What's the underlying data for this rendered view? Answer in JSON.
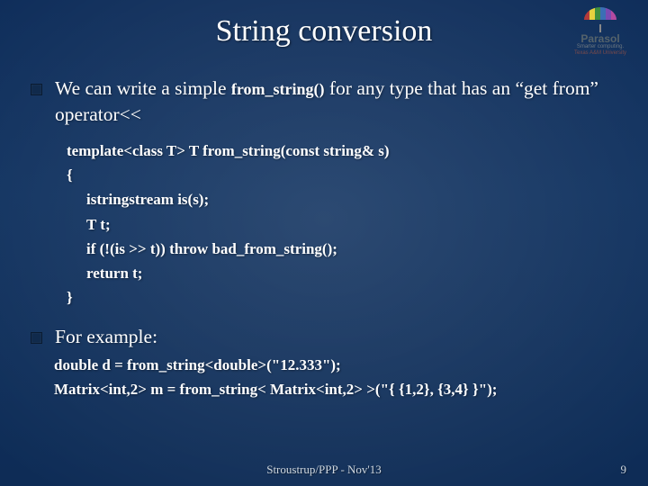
{
  "title": "String conversion",
  "logo": {
    "brand": "Parasol",
    "tag1": "Smarter computing.",
    "tag2": "Texas A&M University"
  },
  "bullets": {
    "b1_prefix": "We can write a simple ",
    "b1_code": "from_string()",
    "b1_suffix": " for any type that has an “get from” operator<<",
    "b2": "For example:"
  },
  "code": {
    "l1": "template<class T> T from_string(const string& s)",
    "l2": "{",
    "l3": "istringstream is(s);",
    "l4": "T t;",
    "l5": "if (!(is >> t)) throw bad_from_string();",
    "l6": "return t;",
    "l7": "}"
  },
  "example": {
    "l1": "double d = from_string<double>(\"12.333\");",
    "l2": "Matrix<int,2> m = from_string< Matrix<int,2> >(\"{ {1,2}, {3,4} }\");"
  },
  "footer": "Stroustrup/PPP - Nov'13",
  "page": "9"
}
